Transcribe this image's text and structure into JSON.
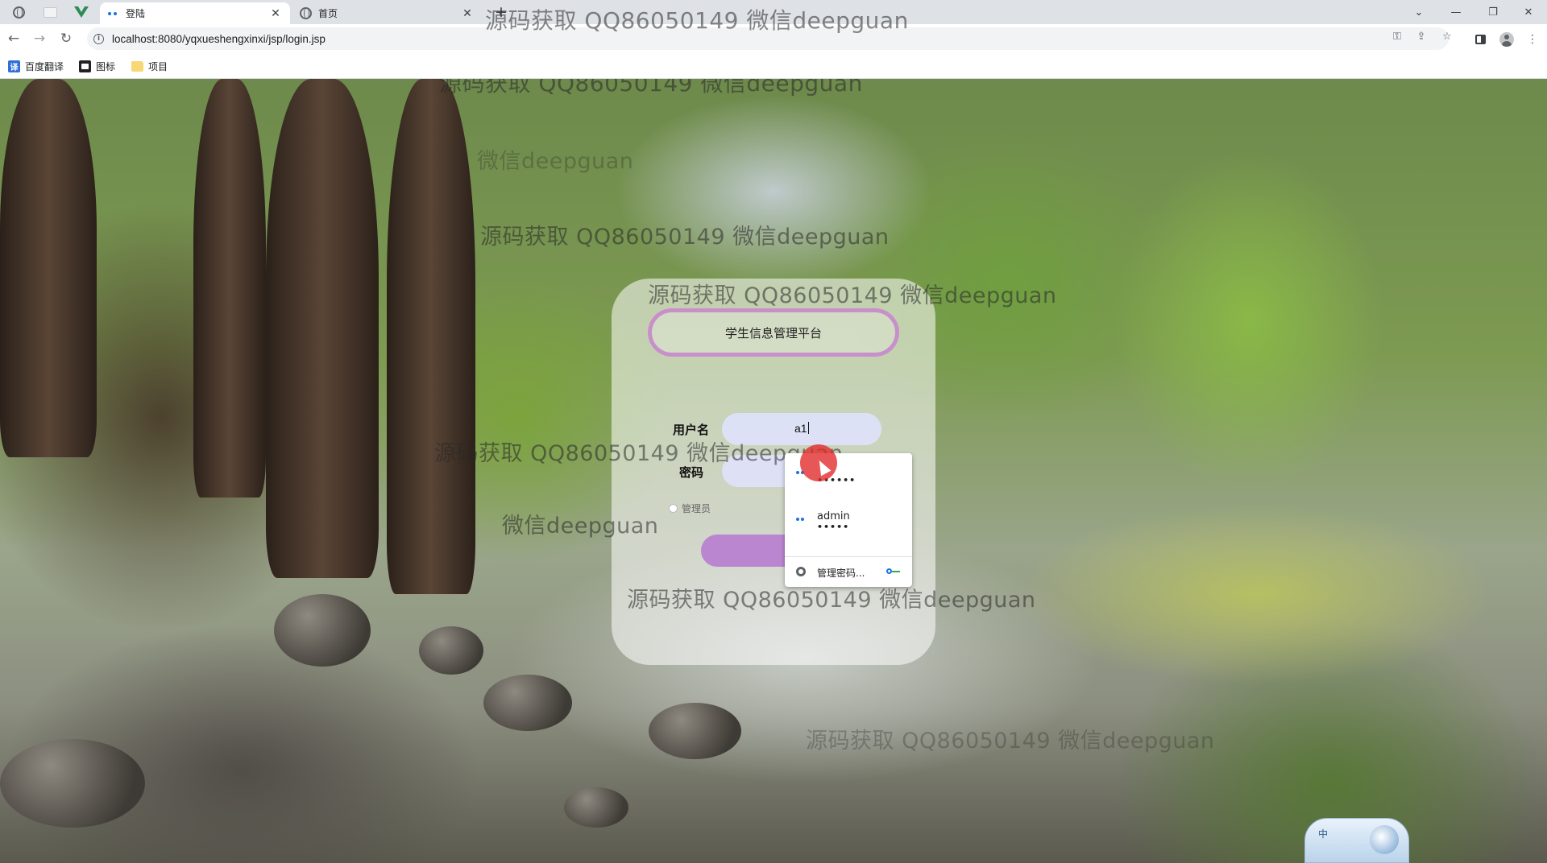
{
  "browser": {
    "tabs": [
      {
        "label": "登陆",
        "active": true
      },
      {
        "label": "首页",
        "active": false
      }
    ],
    "url": "localhost:8080/yqxueshengxinxi/jsp/login.jsp",
    "bookmarks": [
      {
        "label": "百度翻译",
        "icon": "baidu-translate-icon"
      },
      {
        "label": "图标",
        "icon": "image-icon"
      },
      {
        "label": "项目",
        "icon": "folder-icon"
      }
    ]
  },
  "watermarks": [
    "源码获取 QQ86050149 微信deepguan",
    "源码获取 QQ86050149 微信deepguan",
    "微信deepguan",
    "源码获取 QQ86050149 微信deepguan",
    "源码获取 QQ86050149 微信deepguan",
    "源码获取 QQ86050149 微信deepguan",
    "微信deepguan",
    "源码获取 QQ86050149 微信deepguan",
    "源码获取 QQ86050149 微信deepguan"
  ],
  "login": {
    "title": "学生信息管理平台",
    "username_label": "用户名",
    "username_value": "a1",
    "password_label": "密码",
    "role_label": "管理员"
  },
  "autofill": {
    "items": [
      {
        "username": "",
        "password_mask": "••••••"
      },
      {
        "username": "admin",
        "password_mask": "•••••"
      }
    ],
    "manage_label": "管理密码..."
  },
  "ime": {
    "label": "中"
  },
  "colors": {
    "accent_pill": "#bb86d0",
    "input_bg": "#dee1f8",
    "cursor_highlight": "#e12828"
  }
}
